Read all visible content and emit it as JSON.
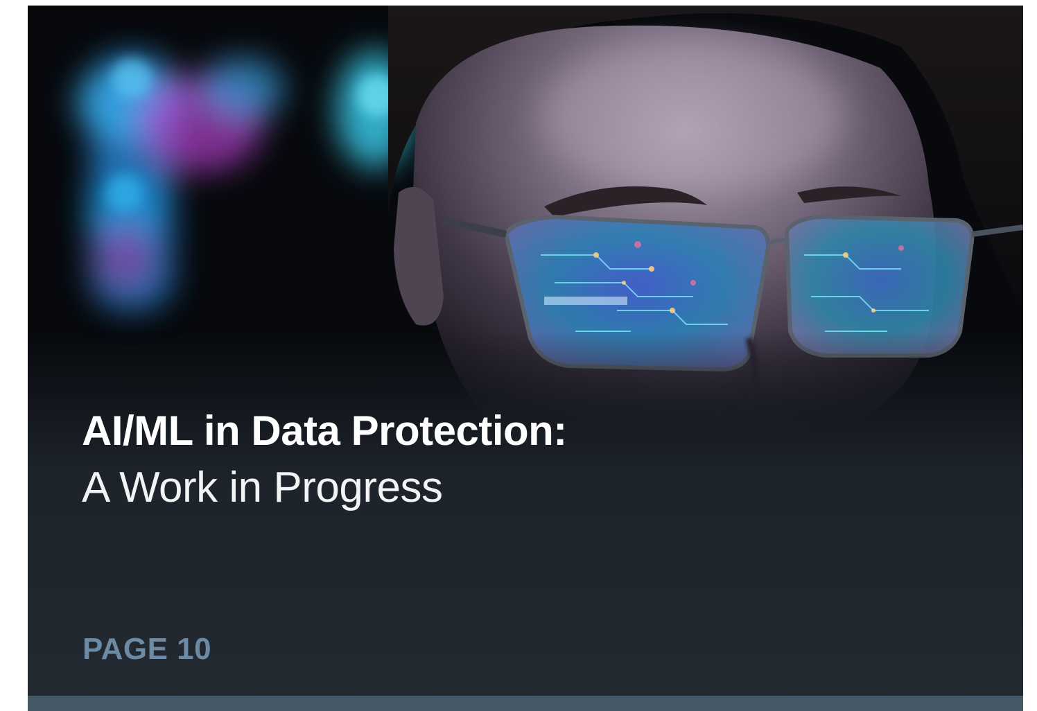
{
  "title": "AI/ML in Data Protection:",
  "subtitle": "A Work in Progress",
  "page_label": "PAGE 10",
  "colors": {
    "background": "#1b2027",
    "title": "#ffffff",
    "page_label": "#6c8aa3",
    "bottom_bar": "#465966"
  },
  "image": {
    "subject": "woman-wearing-glasses-reflecting-circuit-board-icon"
  }
}
